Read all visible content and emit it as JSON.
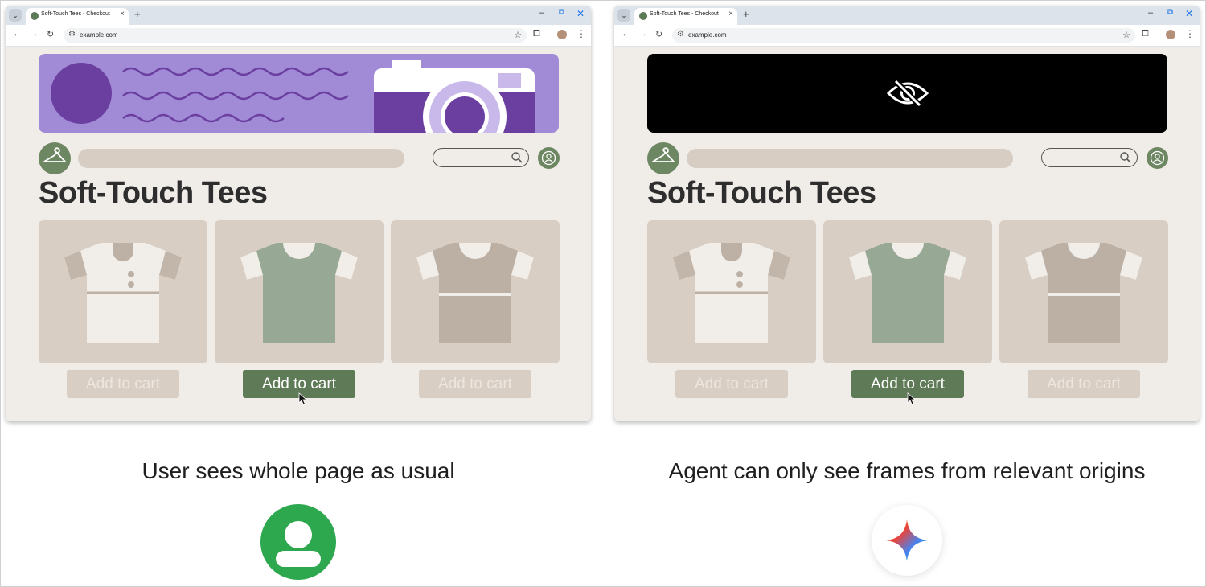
{
  "browser": {
    "tab_menu_icon": "chevron-down-icon",
    "tab_title": "Soft-Touch Tees - Checkout",
    "tab_close": "×",
    "new_tab": "+",
    "url": "example.com",
    "window_controls": {
      "minimize": "–",
      "restore": "⧉",
      "close": "✕"
    }
  },
  "page": {
    "shop_title": "Soft-Touch Tees",
    "products": [
      {
        "name": "henley-tee",
        "button_label": "Add to cart",
        "enabled": false
      },
      {
        "name": "green-tee",
        "button_label": "Add to cart",
        "enabled": true
      },
      {
        "name": "taupe-tee",
        "button_label": "Add to cart",
        "enabled": false
      }
    ]
  },
  "left_panel": {
    "caption": "User sees whole page as usual",
    "banner_state": "visible",
    "icon": "user-avatar-icon"
  },
  "right_panel": {
    "caption": "Agent can only see frames from relevant origins",
    "banner_state": "hidden",
    "banner_icon": "eye-off-icon",
    "icon": "gemini-sparkle-icon"
  },
  "colors": {
    "page_bg": "#f0ece7",
    "banner": "#a18bd6",
    "card": "#d8cec4",
    "button_active": "#5f7a56",
    "user_avatar": "#2da84f"
  }
}
